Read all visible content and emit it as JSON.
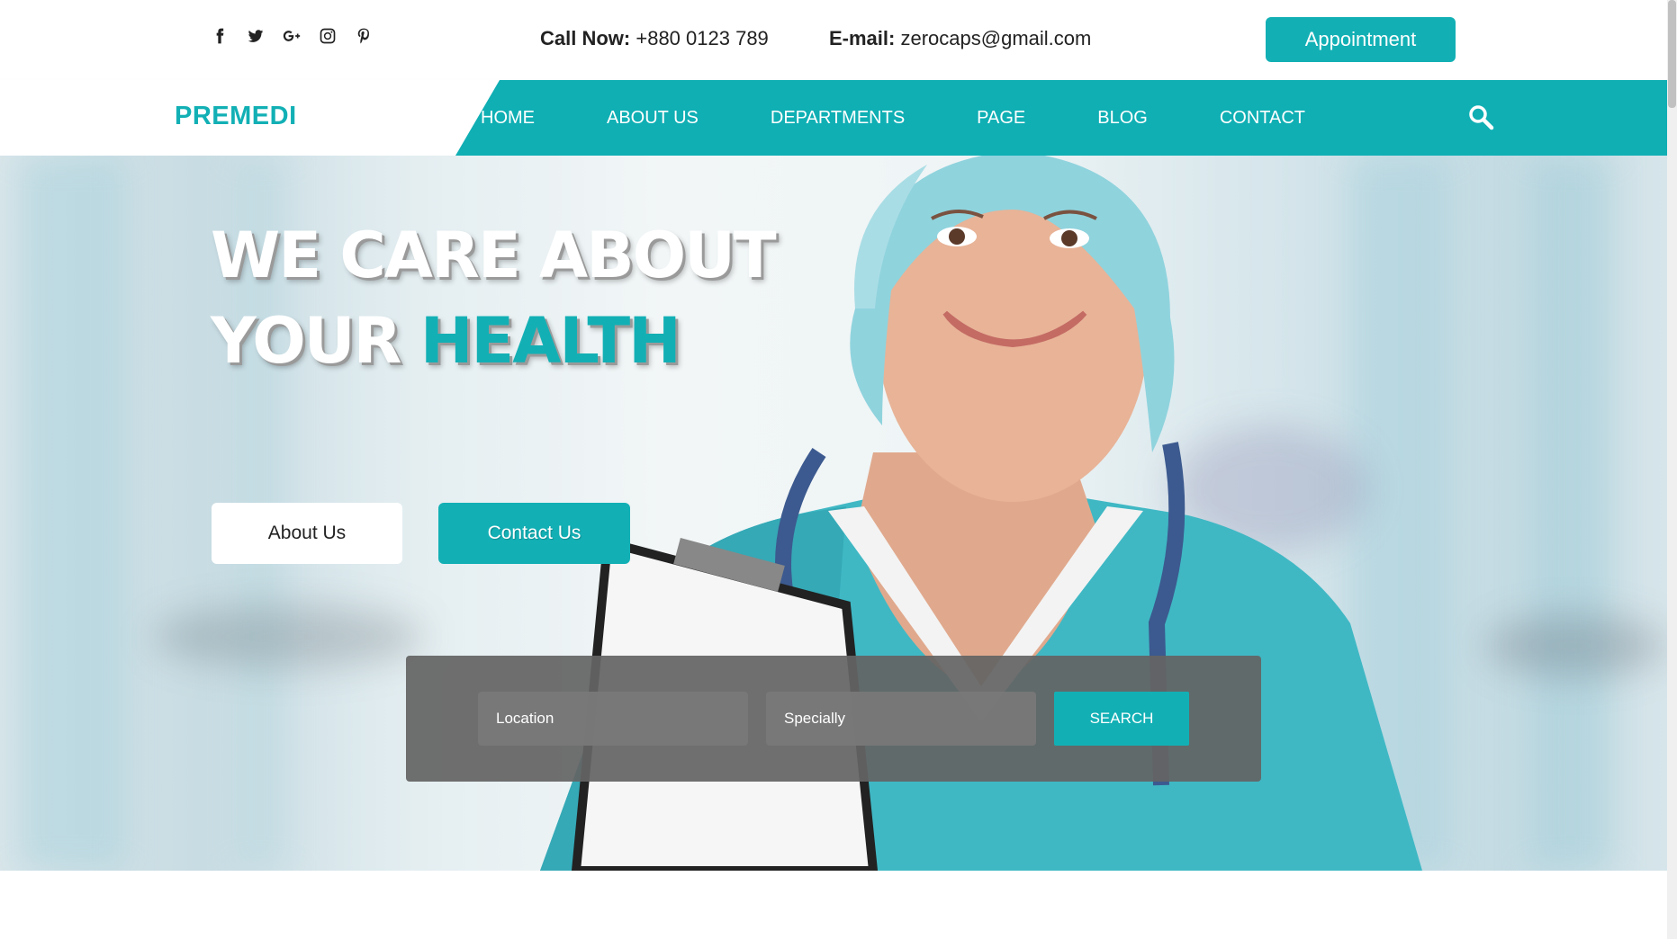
{
  "topbar": {
    "social": [
      "facebook-icon",
      "twitter-icon",
      "google-plus-icon",
      "instagram-icon",
      "pinterest-icon"
    ],
    "call_label": "Call Now:",
    "call_value": "+880 0123 789",
    "email_label": "E-mail:",
    "email_value": "zerocaps@gmail.com",
    "appointment_label": "Appointment"
  },
  "nav": {
    "logo": "PREMEDI",
    "items": [
      "HOME",
      "ABOUT US",
      "DEPARTMENTS",
      "PAGE",
      "BLOG",
      "CONTACT"
    ],
    "search_icon": "search-icon"
  },
  "hero": {
    "line1": "WE CARE ABOUT",
    "line2_plain": "YOUR ",
    "line2_accent": "HEALTH",
    "about_button": "About Us",
    "contact_button": "Contact Us"
  },
  "search": {
    "location_placeholder": "Location",
    "specialty_placeholder": "Specially",
    "button_label": "SEARCH"
  },
  "colors": {
    "accent": "#12b0b5",
    "panel": "#646464"
  }
}
